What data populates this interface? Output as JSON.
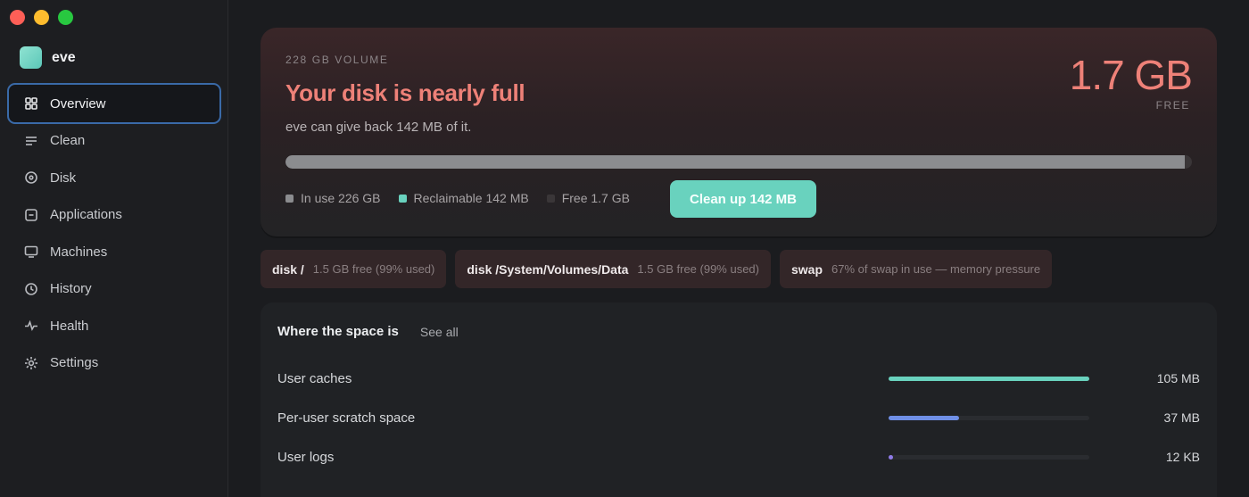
{
  "window": {
    "controls": [
      "close",
      "minimize",
      "zoom"
    ]
  },
  "app": {
    "name": "eve"
  },
  "sidebar": {
    "items": [
      {
        "label": "Overview",
        "icon": "grid-icon",
        "active": true
      },
      {
        "label": "Clean",
        "icon": "lines-icon"
      },
      {
        "label": "Disk",
        "icon": "disk-icon"
      },
      {
        "label": "Applications",
        "icon": "app-icon"
      },
      {
        "label": "Machines",
        "icon": "monitor-icon"
      },
      {
        "label": "History",
        "icon": "clock-icon"
      },
      {
        "label": "Health",
        "icon": "pulse-icon"
      },
      {
        "label": "Settings",
        "icon": "gear-icon"
      }
    ]
  },
  "hero": {
    "volume_label": "228 GB VOLUME",
    "title": "Your disk is nearly full",
    "subtitle": "eve can give back 142 MB of it.",
    "free_value": "1.7 GB",
    "free_label": "FREE",
    "usage_used_fraction": 0.992,
    "legend": [
      {
        "label": "In use 226 GB",
        "color": "#8b8c8f"
      },
      {
        "label": "Reclaimable 142 MB",
        "color": "#69d2be"
      },
      {
        "label": "Free 1.7 GB",
        "color": "#3a3638"
      }
    ],
    "clean_button": "Clean up 142 MB"
  },
  "alerts": [
    {
      "title": "disk /",
      "detail": "1.5 GB free (99% used)"
    },
    {
      "title": "disk /System/Volumes/Data",
      "detail": "1.5 GB free (99% used)"
    },
    {
      "title": "swap",
      "detail": "67% of swap in use — memory pressure"
    }
  ],
  "space": {
    "title": "Where the space is",
    "see_all": "See all",
    "rows": [
      {
        "label": "User caches",
        "size": "105 MB",
        "fraction": 1.0,
        "color": "#69d2be"
      },
      {
        "label": "Per-user scratch space",
        "size": "37 MB",
        "fraction": 0.35,
        "color": "#6f8fe6"
      },
      {
        "label": "User logs",
        "size": "12 KB",
        "fraction": 0.02,
        "color": "#8f7be8"
      }
    ]
  },
  "colors": {
    "accent": "#69d2be",
    "warning": "#ee8178",
    "active_outline": "#3a6aa8"
  }
}
